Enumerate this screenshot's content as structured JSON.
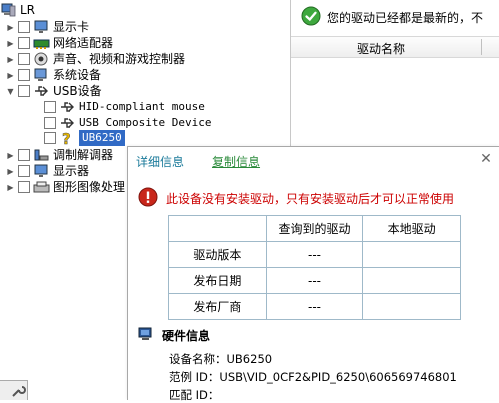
{
  "tree": {
    "root": "LR",
    "items": [
      {
        "label": "显示卡",
        "icon": "display-card-icon"
      },
      {
        "label": "网络适配器",
        "icon": "network-adapter-icon"
      },
      {
        "label": "声音、视频和游戏控制器",
        "icon": "sound-icon"
      },
      {
        "label": "系统设备",
        "icon": "system-device-icon"
      },
      {
        "label": "USB设备",
        "icon": "usb-icon"
      },
      {
        "label": "HID-compliant mouse",
        "icon": "usb-icon"
      },
      {
        "label": "USB Composite Device",
        "icon": "usb-icon"
      },
      {
        "label": "UB6250",
        "icon": "unknown-device-icon"
      },
      {
        "label": "调制解调器",
        "icon": "modem-icon"
      },
      {
        "label": "显示器",
        "icon": "monitor-icon"
      },
      {
        "label": "图形图像处理",
        "icon": "imaging-icon"
      }
    ]
  },
  "right": {
    "status": "您的驱动已经都是最新的，不",
    "column_header": "驱动名称"
  },
  "popup": {
    "tabs": [
      "详细信息",
      "复制信息"
    ],
    "close": "✕",
    "warning": "此设备没有安装驱动，只有安装驱动后才可以正常使用",
    "table": {
      "headers": [
        "",
        "查询到的驱动",
        "本地驱动"
      ],
      "rows": [
        [
          "驱动版本",
          "---",
          ""
        ],
        [
          "发布日期",
          "---",
          ""
        ],
        [
          "发布厂商",
          "---",
          ""
        ]
      ]
    },
    "hw": {
      "title": "硬件信息",
      "device_name": "设备名称：UB6250",
      "example_id": "范例 ID：USB\\VID_0CF2&PID_6250\\606569746801",
      "match_id": "匹配 ID："
    }
  },
  "colors": {
    "selection": "#316ac5",
    "warning_text": "#cc0000",
    "tab_link": "#1a7a9a",
    "tab_active": "#2a8a3a",
    "table_border": "#9fb9c9"
  }
}
